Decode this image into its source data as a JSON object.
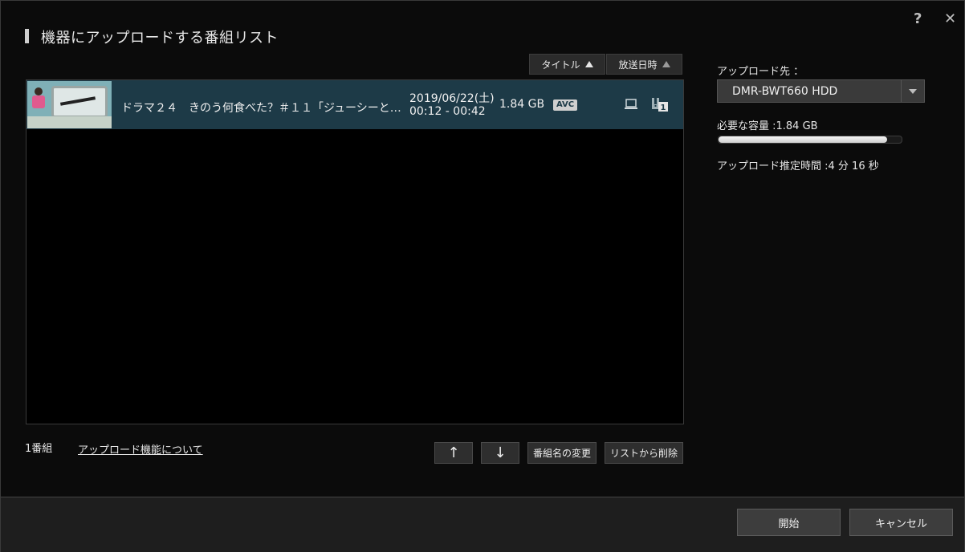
{
  "window": {
    "title": "機器にアップロードする番組リスト"
  },
  "header": {
    "help_icon": "?",
    "close_icon": "✕"
  },
  "sort": {
    "title_label": "タイトル",
    "date_label": "放送日時"
  },
  "list": {
    "items": [
      {
        "title": "ドラマ２４　きのう何食べた？＃１１「ジューシーと…",
        "date": "2019/06/22(土)",
        "time": "00:12 - 00:42",
        "size": "1.84 GB",
        "codec": "AVC",
        "dub_count": "1"
      }
    ]
  },
  "footer_left": {
    "count": "1番組",
    "about_link": "アップロード機能について"
  },
  "actions": {
    "up": "↑",
    "down": "↓",
    "rename": "番組名の変更",
    "remove": "リストから削除"
  },
  "right_panel": {
    "dest_label": "アップロード先 ：",
    "dest_value": "DMR-BWT660 HDD",
    "need_label": "必要な容量 :1.84 GB",
    "capacity_fraction": 0.92,
    "time_label": "アップロード推定時間 :4 分 16 秒"
  },
  "footer": {
    "start": "開始",
    "cancel": "キャンセル"
  },
  "colors": {
    "row_selected": "#1d3a47",
    "background": "#0b0b0b"
  }
}
